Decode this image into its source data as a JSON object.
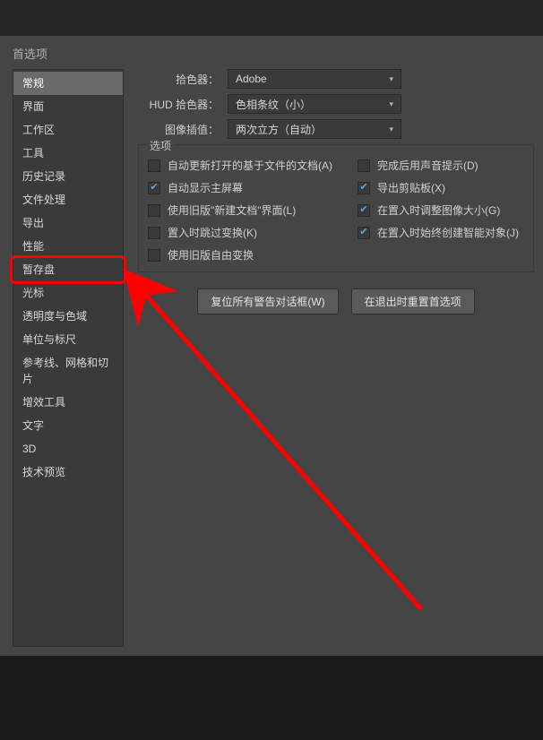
{
  "dialog": {
    "title": "首选项"
  },
  "sidebar": {
    "items": [
      "常规",
      "界面",
      "工作区",
      "工具",
      "历史记录",
      "文件处理",
      "导出",
      "性能",
      "暂存盘",
      "光标",
      "透明度与色域",
      "单位与标尺",
      "参考线、网格和切片",
      "增效工具",
      "文字",
      "3D",
      "技术预览"
    ],
    "selected_index": 0,
    "highlighted_index": 8
  },
  "pickers": {
    "color_picker_label": "拾色器：",
    "color_picker_value": "Adobe",
    "hud_label": "HUD 拾色器：",
    "hud_value": "色相条纹（小）",
    "interp_label": "图像插值：",
    "interp_value": "两次立方（自动）"
  },
  "options": {
    "legend": "选项",
    "items": [
      {
        "label": "自动更新打开的基于文件的文档(A)",
        "checked": false
      },
      {
        "label": "完成后用声音提示(D)",
        "checked": false
      },
      {
        "label": "自动显示主屏幕",
        "checked": true
      },
      {
        "label": "导出剪贴板(X)",
        "checked": true
      },
      {
        "label": "使用旧版\"新建文档\"界面(L)",
        "checked": false
      },
      {
        "label": "在置入时调整图像大小(G)",
        "checked": true
      },
      {
        "label": "置入时跳过变换(K)",
        "checked": false
      },
      {
        "label": "在置入时始终创建智能对象(J)",
        "checked": true
      },
      {
        "label": "使用旧版自由变换",
        "checked": false
      }
    ]
  },
  "buttons": {
    "reset_warnings": "复位所有警告对话框(W)",
    "reset_on_quit": "在退出时重置首选项"
  }
}
